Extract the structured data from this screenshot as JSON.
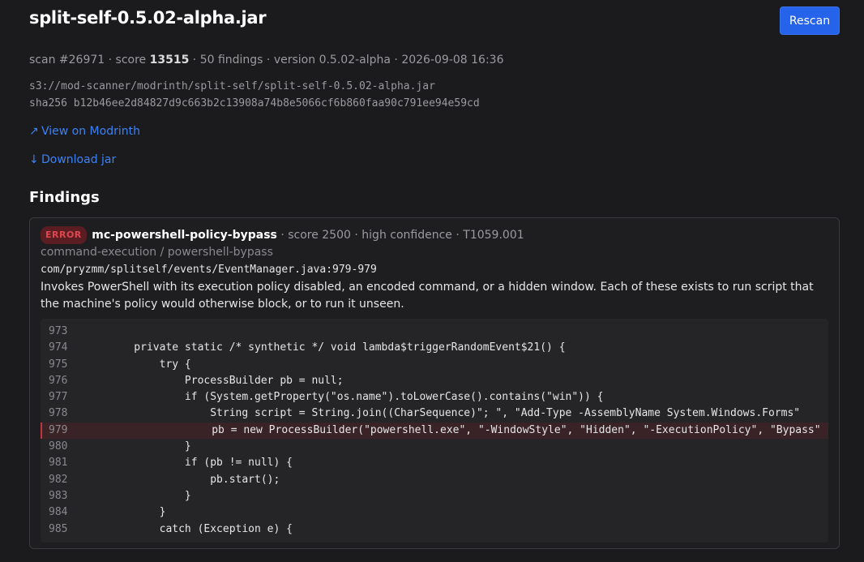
{
  "header": {
    "title": "split-self-0.5.02-alpha.jar",
    "rescan_label": "Rescan"
  },
  "meta": {
    "scan": "scan #26971",
    "score_label": "score",
    "score": "13515",
    "findings": "50 findings",
    "version": "version 0.5.02-alpha",
    "date": "2026-09-08 16:36"
  },
  "paths": {
    "s3": "s3://mod-scanner/modrinth/split-self/split-self-0.5.02-alpha.jar",
    "sha256": "sha256 b12b46ee2d84827d9c663b2c13908a74b8e5066cf6b860faa90c791ee94e59cd"
  },
  "links": {
    "modrinth_icon": "↗",
    "modrinth": "View on Modrinth",
    "download_icon": "↓",
    "download": "Download jar"
  },
  "findings": {
    "title": "Findings",
    "items": [
      {
        "severity": "ERROR",
        "rule": "mc-powershell-policy-bypass",
        "score": "score 2500",
        "confidence": "high confidence",
        "technique": "T1059.001",
        "category": "command-execution / powershell-bypass",
        "location": "com/pryzmm/splitself/events/EventManager.java:979-979",
        "description": "Invokes PowerShell with its execution policy disabled, an encoded command, or a hidden window. Each of these exists to run script that the machine's policy would otherwise block, or to run it unseen.",
        "code": [
          {
            "n": "973",
            "t": ""
          },
          {
            "n": "974",
            "t": "    private static /* synthetic */ void lambda$triggerRandomEvent$21() {"
          },
          {
            "n": "975",
            "t": "        try {"
          },
          {
            "n": "976",
            "t": "            ProcessBuilder pb = null;"
          },
          {
            "n": "977",
            "t": "            if (System.getProperty(\"os.name\").toLowerCase().contains(\"win\")) {"
          },
          {
            "n": "978",
            "t": "                String script = String.join((CharSequence)\"; \", \"Add-Type -AssemblyName System.Windows.Forms\""
          },
          {
            "n": "979",
            "t": "                pb = new ProcessBuilder(\"powershell.exe\", \"-WindowStyle\", \"Hidden\", \"-ExecutionPolicy\", \"Bypass\""
          },
          {
            "n": "980",
            "t": "            }"
          },
          {
            "n": "981",
            "t": "            if (pb != null) {"
          },
          {
            "n": "982",
            "t": "                pb.start();"
          },
          {
            "n": "983",
            "t": "            }"
          },
          {
            "n": "984",
            "t": "        }"
          },
          {
            "n": "985",
            "t": "        catch (Exception e) {"
          }
        ]
      }
    ]
  },
  "colors": {
    "background": "#1b1b1e",
    "accent": "#2563eb",
    "link": "#3b82f6",
    "error": "#e0474f"
  }
}
